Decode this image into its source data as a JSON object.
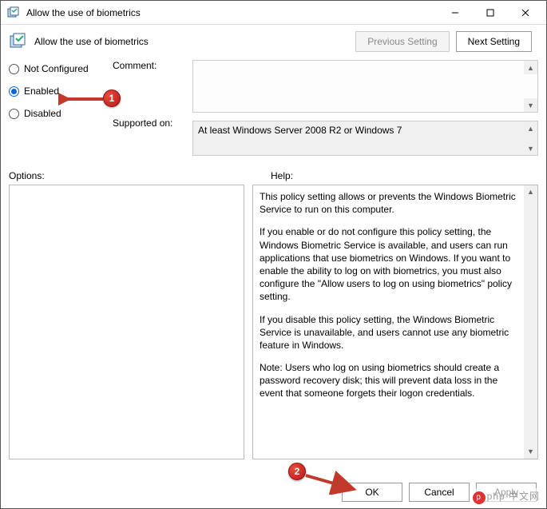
{
  "window": {
    "title": "Allow the use of biometrics"
  },
  "header": {
    "title": "Allow the use of biometrics",
    "prev_label": "Previous Setting",
    "next_label": "Next Setting"
  },
  "radios": {
    "not_configured": "Not Configured",
    "enabled": "Enabled",
    "disabled": "Disabled",
    "selected": "enabled"
  },
  "labels": {
    "comment": "Comment:",
    "supported_on": "Supported on:",
    "options": "Options:",
    "help": "Help:"
  },
  "fields": {
    "comment_value": "",
    "supported_on_value": "At least Windows Server 2008 R2 or Windows 7"
  },
  "help": {
    "p1": "This policy setting allows or prevents the Windows Biometric Service to run on this computer.",
    "p2": "If you enable or do not configure this policy setting, the Windows Biometric Service is available, and users can run applications that use biometrics on Windows. If you want to enable the ability to log on with biometrics, you must also configure the \"Allow users to log on using biometrics\" policy setting.",
    "p3": "If you disable this policy setting, the Windows Biometric Service is unavailable, and users cannot use any biometric feature in Windows.",
    "p4": "Note: Users who log on using biometrics should create a password recovery disk; this will prevent data loss in the event that someone forgets their logon credentials."
  },
  "footer": {
    "ok": "OK",
    "cancel": "Cancel",
    "apply": "Apply"
  },
  "annotations": {
    "badge1": "1",
    "badge2": "2"
  },
  "watermark": "php 中文网"
}
